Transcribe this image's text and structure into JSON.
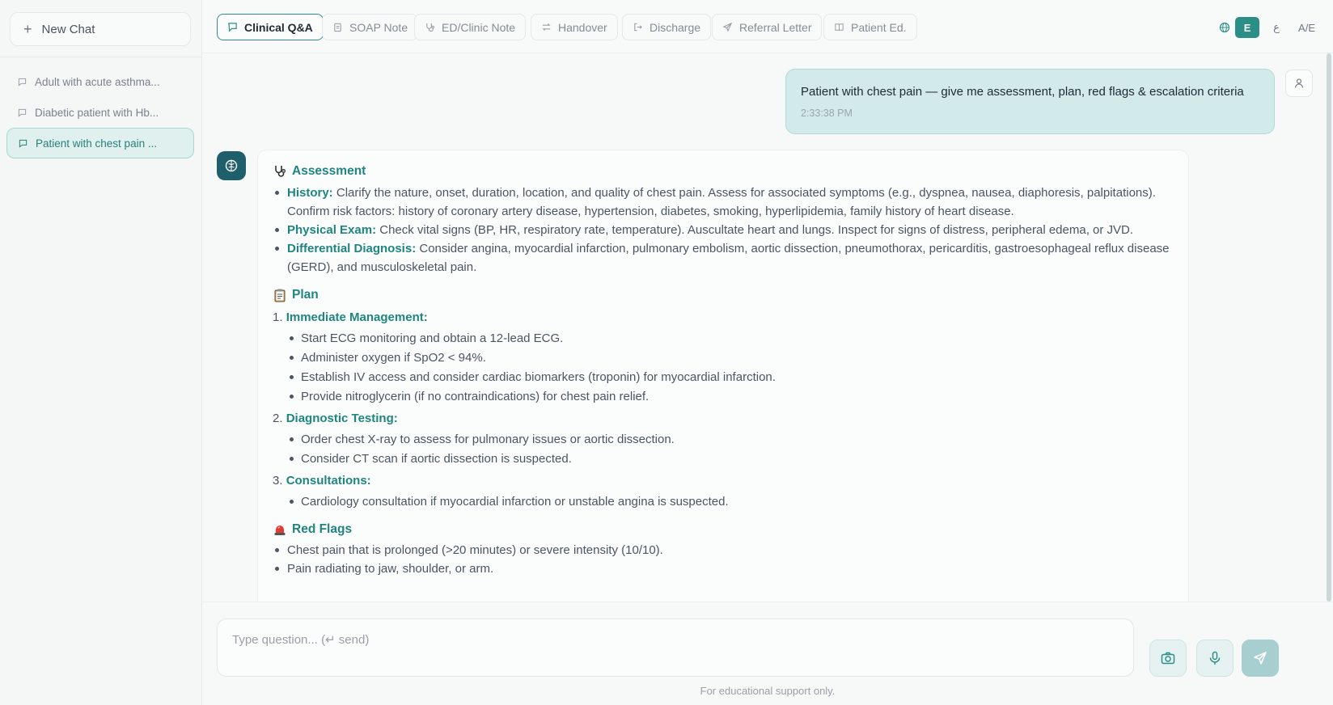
{
  "sidebar": {
    "new_chat_label": "New Chat",
    "chats": [
      {
        "label": "Adult with acute asthma..."
      },
      {
        "label": "Diabetic patient with Hb..."
      },
      {
        "label": "Patient with chest pain ..."
      }
    ]
  },
  "toolbar": {
    "tabs": [
      {
        "label": "Clinical Q&A",
        "icon": "chat-icon"
      },
      {
        "label": "SOAP Note",
        "icon": "clipboard-icon"
      },
      {
        "label": "ED/Clinic Note",
        "icon": "stethoscope-icon"
      },
      {
        "label": "Handover",
        "icon": "swap-icon"
      },
      {
        "label": "Discharge",
        "icon": "exit-icon"
      },
      {
        "label": "Referral Letter",
        "icon": "send-icon"
      },
      {
        "label": "Patient Ed.",
        "icon": "book-icon"
      }
    ],
    "languages": [
      "E",
      "ع",
      "A/E"
    ]
  },
  "conversation": {
    "user_message": "Patient with chest pain — give me assessment, plan, red flags & escalation criteria",
    "user_time": "2:33:38 PM",
    "assessment": {
      "title": "Assessment",
      "items": [
        {
          "label": "History:",
          "text": " Clarify the nature, onset, duration, location, and quality of chest pain. Assess for associated symptoms (e.g., dyspnea, nausea, diaphoresis, palpitations). Confirm risk factors: history of coronary artery disease, hypertension, diabetes, smoking, hyperlipidemia, family history of heart disease."
        },
        {
          "label": "Physical Exam:",
          "text": " Check vital signs (BP, HR, respiratory rate, temperature). Auscultate heart and lungs. Inspect for signs of distress, peripheral edema, or JVD."
        },
        {
          "label": "Differential Diagnosis:",
          "text": " Consider angina, myocardial infarction, pulmonary embolism, aortic dissection, pneumothorax, pericarditis, gastroesophageal reflux disease (GERD), and musculoskeletal pain."
        }
      ]
    },
    "plan": {
      "title": "Plan",
      "steps": [
        {
          "num": "1.",
          "label": "Immediate Management:",
          "items": [
            "Start ECG monitoring and obtain a 12-lead ECG.",
            "Administer oxygen if SpO2 < 94%.",
            "Establish IV access and consider cardiac biomarkers (troponin) for myocardial infarction.",
            "Provide nitroglycerin (if no contraindications) for chest pain relief."
          ]
        },
        {
          "num": "2.",
          "label": "Diagnostic Testing:",
          "items": [
            "Order chest X-ray to assess for pulmonary issues or aortic dissection.",
            "Consider CT scan if aortic dissection is suspected."
          ]
        },
        {
          "num": "3.",
          "label": "Consultations:",
          "items": [
            "Cardiology consultation if myocardial infarction or unstable angina is suspected."
          ]
        }
      ]
    },
    "red_flags": {
      "title": "Red Flags",
      "items": [
        "Chest pain that is prolonged (>20 minutes) or severe intensity (10/10).",
        "Pain radiating to jaw, shoulder, or arm."
      ]
    }
  },
  "composer": {
    "placeholder": "Type question... (↵ send)",
    "footer": "For educational support only."
  },
  "colors": {
    "accent": "#2b8f87",
    "heading": "#1f8580",
    "user_bubble": "#d3eaea"
  }
}
